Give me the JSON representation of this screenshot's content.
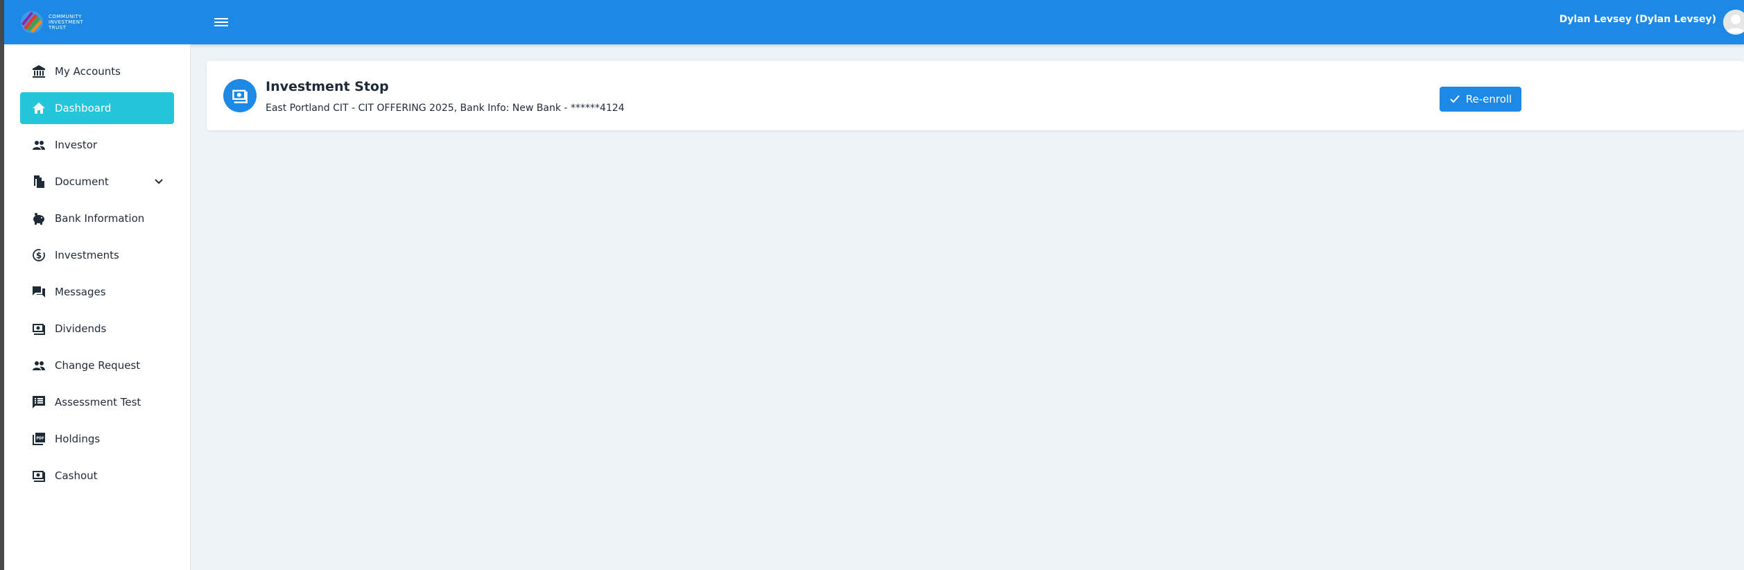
{
  "brand": {
    "logo_lines": [
      "COMMUNITY",
      "INVESTMENT",
      "TRUST"
    ]
  },
  "header": {
    "user_name": "Dylan Levsey (Dylan Levsey)"
  },
  "sidebar": {
    "items": [
      {
        "label": "My Accounts",
        "icon": "bank-icon",
        "active": false
      },
      {
        "label": "Dashboard",
        "icon": "home-icon",
        "active": true
      },
      {
        "label": "Investor",
        "icon": "people-icon",
        "active": false
      },
      {
        "label": "Document",
        "icon": "document-icon",
        "active": false,
        "has_dropdown": true
      },
      {
        "label": "Bank Information",
        "icon": "piggy-bank-icon",
        "active": false
      },
      {
        "label": "Investments",
        "icon": "dollar-cycle-icon",
        "active": false
      },
      {
        "label": "Messages",
        "icon": "chat-icon",
        "active": false
      },
      {
        "label": "Dividends",
        "icon": "cash-icon",
        "active": false
      },
      {
        "label": "Change Request",
        "icon": "people-icon",
        "active": false
      },
      {
        "label": "Assessment Test",
        "icon": "list-icon",
        "active": false
      },
      {
        "label": "Holdings",
        "icon": "pdf-icon",
        "active": false
      },
      {
        "label": "Cashout",
        "icon": "cash-icon",
        "active": false
      }
    ]
  },
  "card": {
    "title": "Investment Stop",
    "subtitle": "East Portland CIT - CIT OFFERING 2025, Bank Info: New Bank - ******4124",
    "button_label": "Re-enroll",
    "icon": "cash-icon"
  },
  "colors": {
    "primary": "#1e88e5",
    "active_nav": "#26c6da",
    "background": "#eef3f7"
  }
}
